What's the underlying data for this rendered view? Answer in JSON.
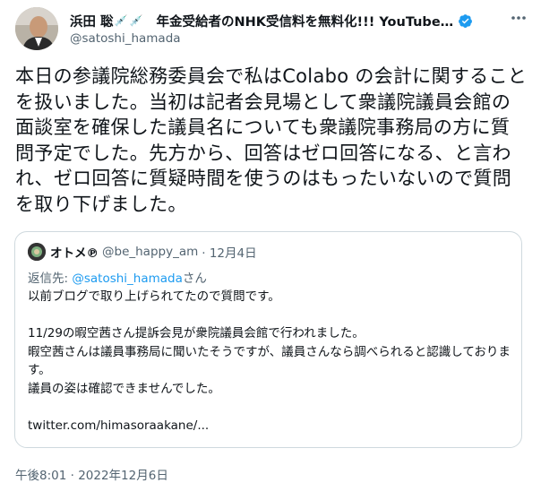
{
  "author": {
    "display_name": "浜田 聡",
    "name_suffix": "年金受給者のNHK受信料を無料化!!!  YouTube…",
    "handle": "@satoshi_hamada",
    "verified_color": "#1d9bf0"
  },
  "tweet": {
    "text": "本日の参議院総務委員会で私はColabo の会計に関することを扱いました。当初は記者会見場として衆議院議員会館の面談室を確保した議員名についても衆議院事務局の方に質問予定でした。先方から、回答はゼロ回答になる、と言われ、ゼロ回答に質疑時間を使うのはもったいないので質問を取り下げました。",
    "timestamp": "午後8:01 · 2022年12月6日"
  },
  "quote": {
    "display_name": "オトメ℗",
    "handle": "@be_happy_am",
    "date": "· 12月4日",
    "reply_prefix": "返信先: ",
    "reply_handle": "@satoshi_hamada",
    "reply_suffix": "さん",
    "text": "以前ブログで取り上げられてたので質問です。\n\n11/29の暇空茜さん提訴会見が衆院議員会館で行われました。\n暇空茜さんは議員事務局に聞いたそうですが、議員さんなら調べられると認識しております。\n議員の姿は確認できませんでした。\n\ntwitter.com/himasoraakane/..."
  },
  "icons": {
    "more": "more-icon",
    "verified": "verified-badge-icon",
    "syringe": "syringe-emoji-icon"
  }
}
